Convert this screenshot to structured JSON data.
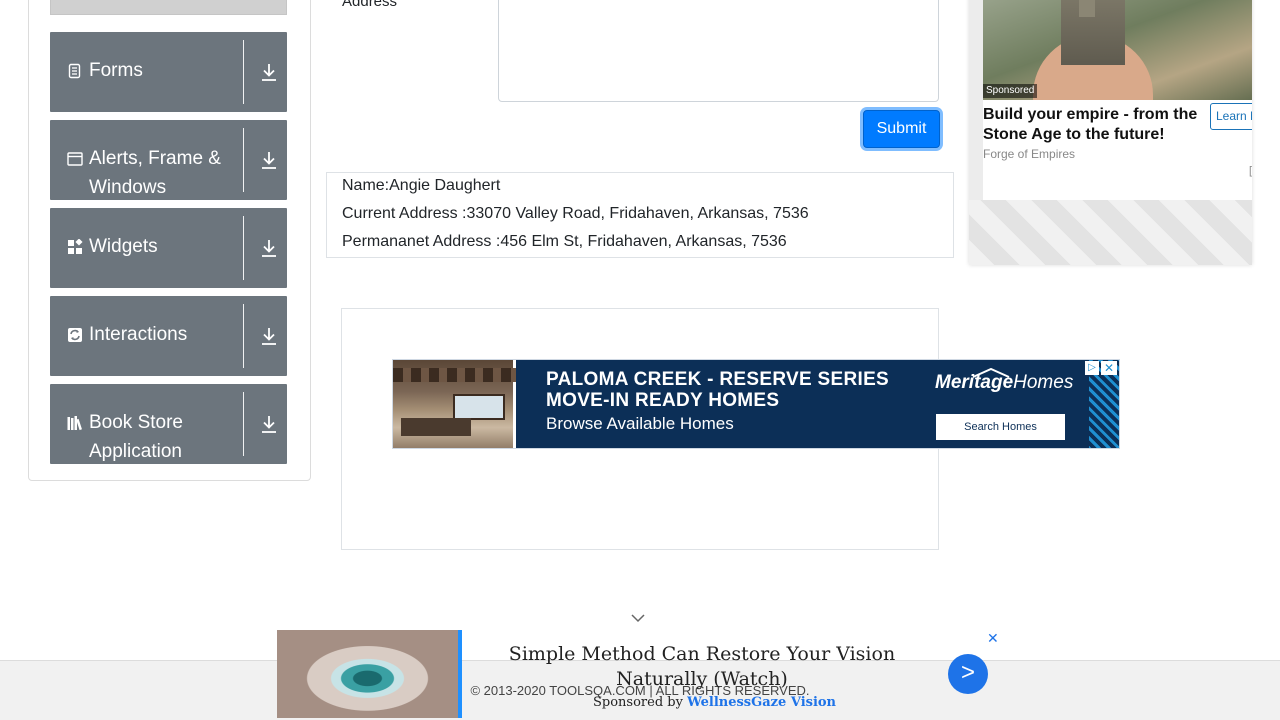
{
  "sidebar": {
    "groups": [
      {
        "label": "Forms",
        "icon": "form-icon"
      },
      {
        "label": "Alerts, Frame & Windows",
        "icon": "window-icon"
      },
      {
        "label": "Widgets",
        "icon": "widgets-icon"
      },
      {
        "label": "Interactions",
        "icon": "interactions-icon"
      },
      {
        "label": "Book Store Application",
        "icon": "book-icon"
      }
    ]
  },
  "form": {
    "address_label": "Address",
    "submit_label": "Submit"
  },
  "output": {
    "name": "Name:Angie Daughert",
    "current_address": "Current Address :33070 Valley Road, Fridahaven, Arkansas, 7536",
    "permanent_address": "Permananet Address :456 Elm St, Fridahaven, Arkansas, 7536"
  },
  "banner_ad": {
    "line1": "PALOMA CREEK - RESERVE SERIES",
    "line2": "MOVE-IN READY HOMES",
    "line3": "Browse Available Homes",
    "logo_bold": "Meritage",
    "logo_thin": "Homes",
    "cta": "Search Homes",
    "adchoices": "▷",
    "close": "✕"
  },
  "right_ad": {
    "sponsored": "Sponsored",
    "title": "Build your empire - from the Stone Age to the future!",
    "brand": "Forge of Empires",
    "cta": "Learn More",
    "help": "[?] |"
  },
  "bottom_ad": {
    "headline": "Simple Method Can Restore Your Vision Naturally (Watch)",
    "sponsor_prefix": "Sponsored by ",
    "sponsor_name": "WellnessGaze Vision",
    "go": ">",
    "close": "✕"
  },
  "footer": {
    "copyright": "© 2013-2020 TOOLSQA.COM | ALL RIGHTS RESERVED."
  },
  "colors": {
    "group_bg": "#6c757d",
    "primary": "#007bff",
    "banner_bg": "#0c2f57"
  }
}
